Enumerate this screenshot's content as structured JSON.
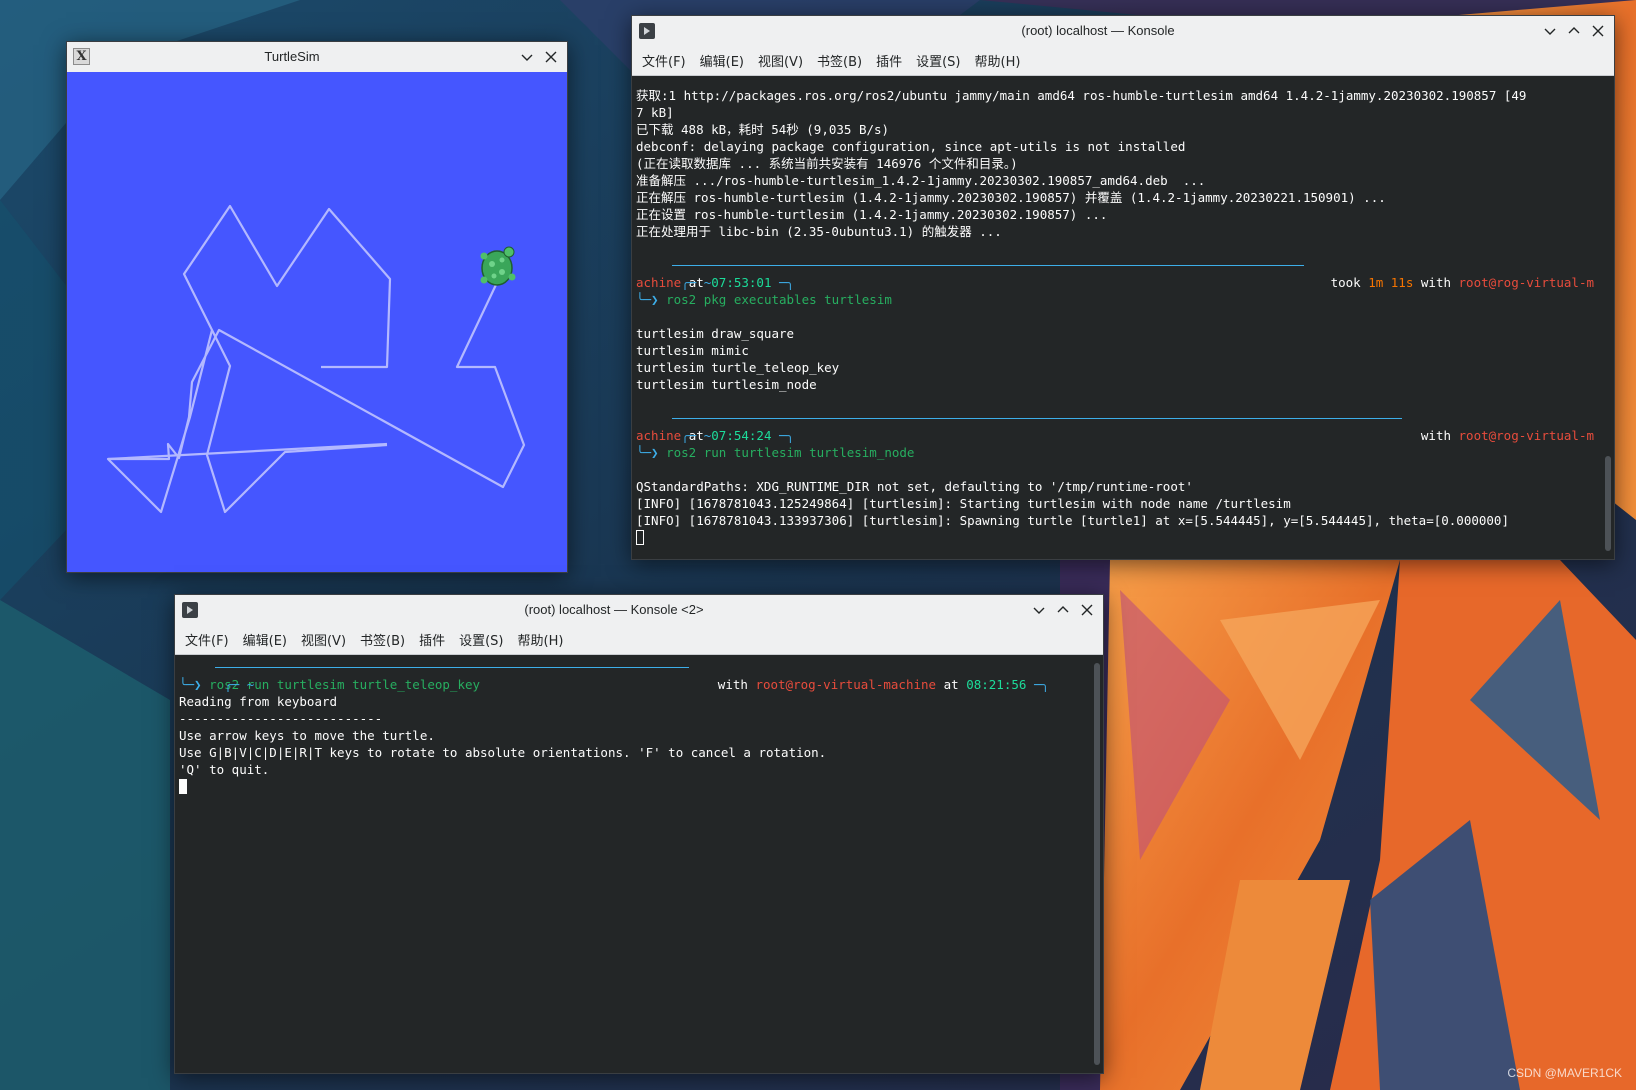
{
  "colors": {
    "turtle_bg": "#4556ff",
    "trail": "#b3b8ff",
    "turtle": "#3aa65a",
    "prompt_user": "#f67400",
    "prompt_host": "#e74c3c",
    "prompt_time": "#1cdc9a",
    "command": "#27ae60"
  },
  "turtlesim": {
    "title": "TurtleSim",
    "icon": "x-icon"
  },
  "konsole1": {
    "title": "(root) localhost — Konsole",
    "menu": [
      "文件(F)",
      "编辑(E)",
      "视图(V)",
      "书签(B)",
      "插件",
      "设置(S)",
      "帮助(H)"
    ],
    "lines": {
      "l1": "获取:1 http://packages.ros.org/ros2/ubuntu jammy/main amd64 ros-humble-turtlesim amd64 1.4.2-1jammy.20230302.190857 [49",
      "l2": "7 kB]",
      "l3": "已下载 488 kB，耗时 54秒 (9,035 B/s)",
      "l4": "debconf: delaying package configuration, since apt-utils is not installed",
      "l5": "(正在读取数据库 ... 系统当前共安装有 146976 个文件和目录。)",
      "l6": "准备解压 .../ros-humble-turtlesim_1.4.2-1jammy.20230302.190857_amd64.deb  ...",
      "l7": "正在解压 ros-humble-turtlesim (1.4.2-1jammy.20230302.190857) 并覆盖 (1.4.2-1jammy.20230221.150901) ...",
      "l8": "正在设置 ros-humble-turtlesim (1.4.2-1jammy.20230302.190857) ...",
      "l9": "正在处理用于 libc-bin (2.35-0ubuntu3.1) 的触发器 ..."
    },
    "p1": {
      "cwd": "~",
      "took": "took",
      "duration": "1m 11s",
      "with": "with",
      "host": "root@rog-virtual-m",
      "user": "achine",
      "at": "at",
      "time": "07:53:01",
      "cmd": "ros2 pkg executables turtlesim"
    },
    "out1": [
      "turtlesim draw_square",
      "turtlesim mimic",
      "turtlesim turtle_teleop_key",
      "turtlesim turtlesim_node"
    ],
    "p2": {
      "cwd": "~",
      "with": "with",
      "host": "root@rog-virtual-m",
      "user": "achine",
      "at": "at",
      "time": "07:54:24",
      "cmd": "ros2 run turtlesim turtlesim_node"
    },
    "out2": [
      "QStandardPaths: XDG_RUNTIME_DIR not set, defaulting to '/tmp/runtime-root'",
      "[INFO] [1678781043.125249864] [turtlesim]: Starting turtlesim with node name /turtlesim",
      "[INFO] [1678781043.133937306] [turtlesim]: Spawning turtle [turtle1] at x=[5.544445], y=[5.544445], theta=[0.000000]"
    ]
  },
  "konsole2": {
    "title": "(root) localhost — Konsole <2>",
    "menu": [
      "文件(F)",
      "编辑(E)",
      "视图(V)",
      "书签(B)",
      "插件",
      "设置(S)",
      "帮助(H)"
    ],
    "p": {
      "cwd": "~",
      "with": "with",
      "host": "root@rog-virtual-machine",
      "at": "at",
      "time": "08:21:56",
      "cmd": "ros2 run turtlesim turtle_teleop_key"
    },
    "out": [
      "Reading from keyboard",
      "---------------------------",
      "Use arrow keys to move the turtle.",
      "Use G|B|V|C|D|E|R|T keys to rotate to absolute orientations. 'F' to cancel a rotation.",
      "'Q' to quit."
    ]
  },
  "watermark": "CSDN @MAVER1CK"
}
